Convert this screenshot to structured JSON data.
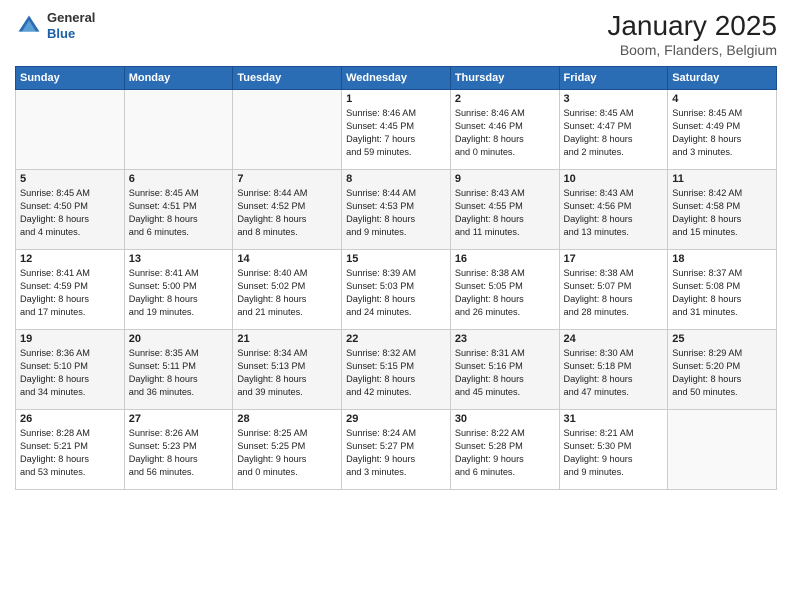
{
  "header": {
    "logo_general": "General",
    "logo_blue": "Blue",
    "title": "January 2025",
    "subtitle": "Boom, Flanders, Belgium"
  },
  "weekdays": [
    "Sunday",
    "Monday",
    "Tuesday",
    "Wednesday",
    "Thursday",
    "Friday",
    "Saturday"
  ],
  "weeks": [
    [
      {
        "day": "",
        "detail": ""
      },
      {
        "day": "",
        "detail": ""
      },
      {
        "day": "",
        "detail": ""
      },
      {
        "day": "1",
        "detail": "Sunrise: 8:46 AM\nSunset: 4:45 PM\nDaylight: 7 hours\nand 59 minutes."
      },
      {
        "day": "2",
        "detail": "Sunrise: 8:46 AM\nSunset: 4:46 PM\nDaylight: 8 hours\nand 0 minutes."
      },
      {
        "day": "3",
        "detail": "Sunrise: 8:45 AM\nSunset: 4:47 PM\nDaylight: 8 hours\nand 2 minutes."
      },
      {
        "day": "4",
        "detail": "Sunrise: 8:45 AM\nSunset: 4:49 PM\nDaylight: 8 hours\nand 3 minutes."
      }
    ],
    [
      {
        "day": "5",
        "detail": "Sunrise: 8:45 AM\nSunset: 4:50 PM\nDaylight: 8 hours\nand 4 minutes."
      },
      {
        "day": "6",
        "detail": "Sunrise: 8:45 AM\nSunset: 4:51 PM\nDaylight: 8 hours\nand 6 minutes."
      },
      {
        "day": "7",
        "detail": "Sunrise: 8:44 AM\nSunset: 4:52 PM\nDaylight: 8 hours\nand 8 minutes."
      },
      {
        "day": "8",
        "detail": "Sunrise: 8:44 AM\nSunset: 4:53 PM\nDaylight: 8 hours\nand 9 minutes."
      },
      {
        "day": "9",
        "detail": "Sunrise: 8:43 AM\nSunset: 4:55 PM\nDaylight: 8 hours\nand 11 minutes."
      },
      {
        "day": "10",
        "detail": "Sunrise: 8:43 AM\nSunset: 4:56 PM\nDaylight: 8 hours\nand 13 minutes."
      },
      {
        "day": "11",
        "detail": "Sunrise: 8:42 AM\nSunset: 4:58 PM\nDaylight: 8 hours\nand 15 minutes."
      }
    ],
    [
      {
        "day": "12",
        "detail": "Sunrise: 8:41 AM\nSunset: 4:59 PM\nDaylight: 8 hours\nand 17 minutes."
      },
      {
        "day": "13",
        "detail": "Sunrise: 8:41 AM\nSunset: 5:00 PM\nDaylight: 8 hours\nand 19 minutes."
      },
      {
        "day": "14",
        "detail": "Sunrise: 8:40 AM\nSunset: 5:02 PM\nDaylight: 8 hours\nand 21 minutes."
      },
      {
        "day": "15",
        "detail": "Sunrise: 8:39 AM\nSunset: 5:03 PM\nDaylight: 8 hours\nand 24 minutes."
      },
      {
        "day": "16",
        "detail": "Sunrise: 8:38 AM\nSunset: 5:05 PM\nDaylight: 8 hours\nand 26 minutes."
      },
      {
        "day": "17",
        "detail": "Sunrise: 8:38 AM\nSunset: 5:07 PM\nDaylight: 8 hours\nand 28 minutes."
      },
      {
        "day": "18",
        "detail": "Sunrise: 8:37 AM\nSunset: 5:08 PM\nDaylight: 8 hours\nand 31 minutes."
      }
    ],
    [
      {
        "day": "19",
        "detail": "Sunrise: 8:36 AM\nSunset: 5:10 PM\nDaylight: 8 hours\nand 34 minutes."
      },
      {
        "day": "20",
        "detail": "Sunrise: 8:35 AM\nSunset: 5:11 PM\nDaylight: 8 hours\nand 36 minutes."
      },
      {
        "day": "21",
        "detail": "Sunrise: 8:34 AM\nSunset: 5:13 PM\nDaylight: 8 hours\nand 39 minutes."
      },
      {
        "day": "22",
        "detail": "Sunrise: 8:32 AM\nSunset: 5:15 PM\nDaylight: 8 hours\nand 42 minutes."
      },
      {
        "day": "23",
        "detail": "Sunrise: 8:31 AM\nSunset: 5:16 PM\nDaylight: 8 hours\nand 45 minutes."
      },
      {
        "day": "24",
        "detail": "Sunrise: 8:30 AM\nSunset: 5:18 PM\nDaylight: 8 hours\nand 47 minutes."
      },
      {
        "day": "25",
        "detail": "Sunrise: 8:29 AM\nSunset: 5:20 PM\nDaylight: 8 hours\nand 50 minutes."
      }
    ],
    [
      {
        "day": "26",
        "detail": "Sunrise: 8:28 AM\nSunset: 5:21 PM\nDaylight: 8 hours\nand 53 minutes."
      },
      {
        "day": "27",
        "detail": "Sunrise: 8:26 AM\nSunset: 5:23 PM\nDaylight: 8 hours\nand 56 minutes."
      },
      {
        "day": "28",
        "detail": "Sunrise: 8:25 AM\nSunset: 5:25 PM\nDaylight: 9 hours\nand 0 minutes."
      },
      {
        "day": "29",
        "detail": "Sunrise: 8:24 AM\nSunset: 5:27 PM\nDaylight: 9 hours\nand 3 minutes."
      },
      {
        "day": "30",
        "detail": "Sunrise: 8:22 AM\nSunset: 5:28 PM\nDaylight: 9 hours\nand 6 minutes."
      },
      {
        "day": "31",
        "detail": "Sunrise: 8:21 AM\nSunset: 5:30 PM\nDaylight: 9 hours\nand 9 minutes."
      },
      {
        "day": "",
        "detail": ""
      }
    ]
  ]
}
